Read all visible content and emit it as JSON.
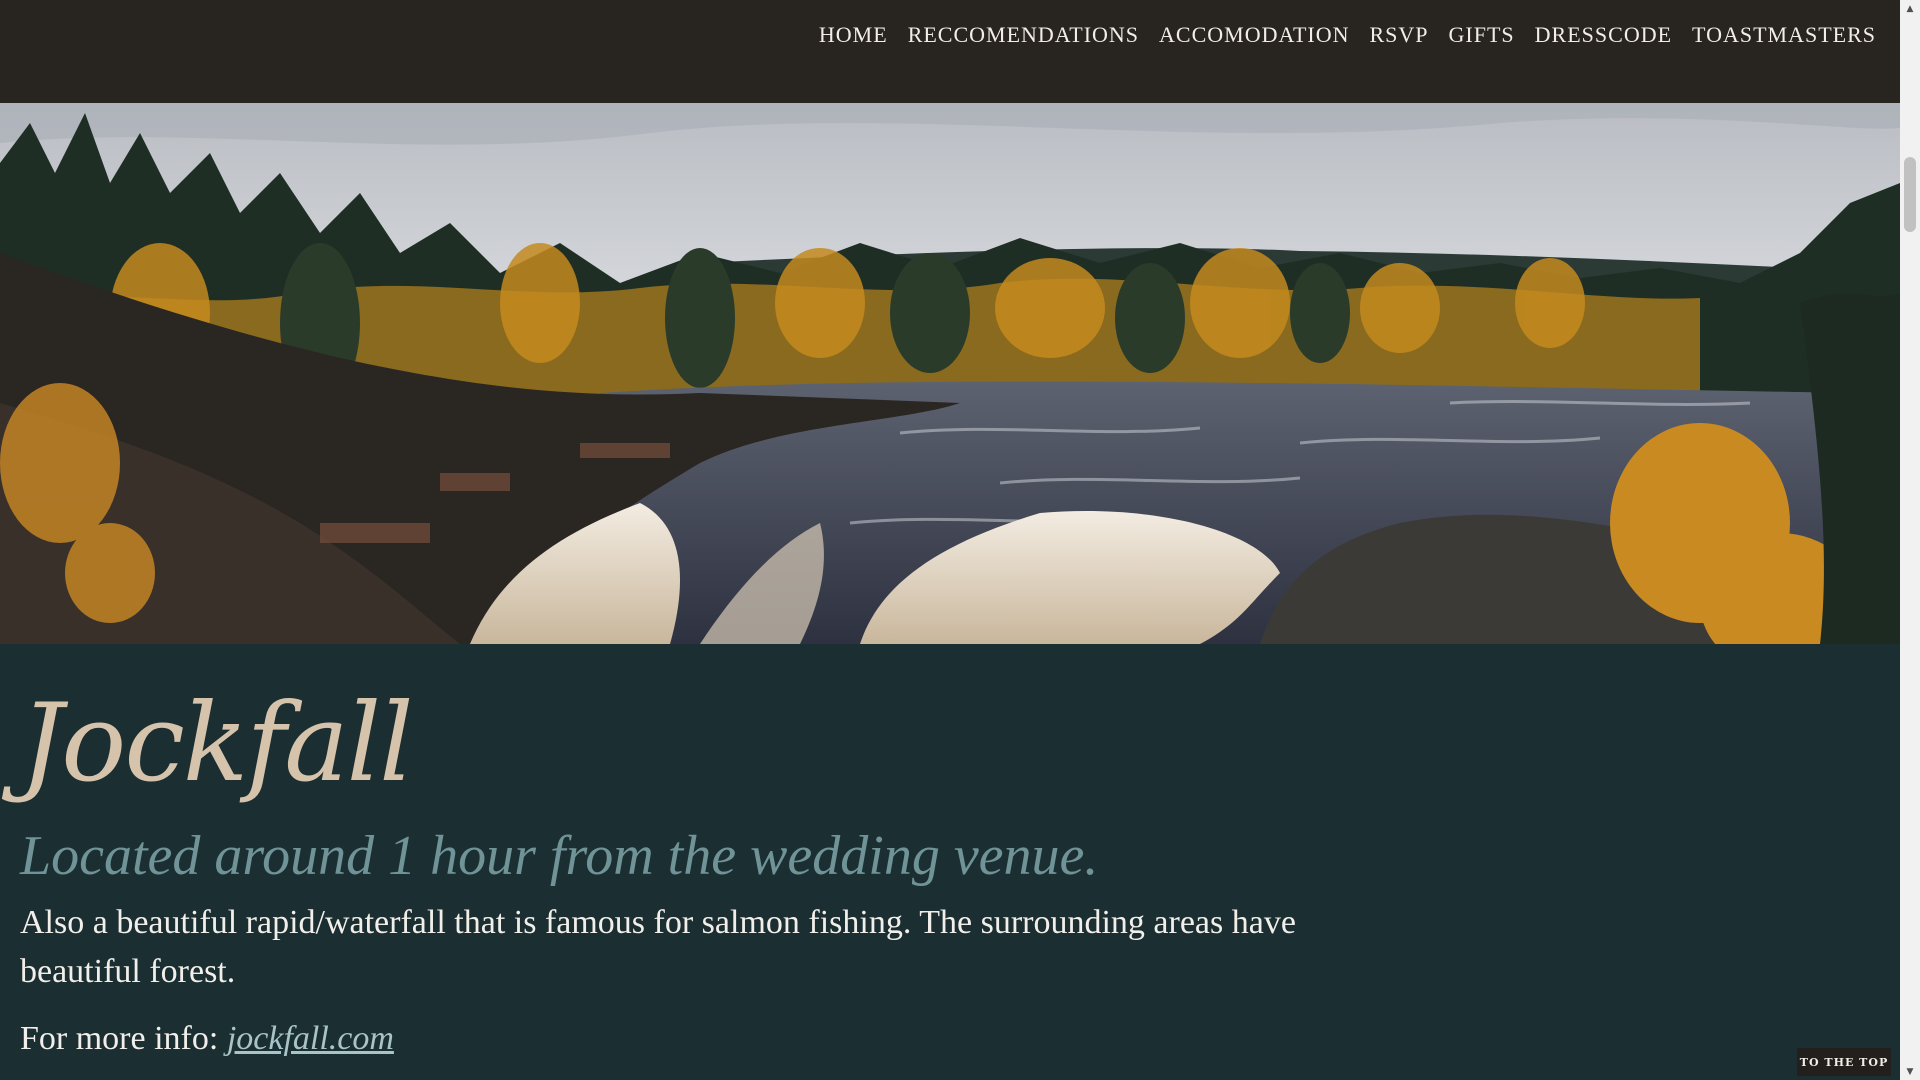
{
  "nav": {
    "items": [
      {
        "label": "HOME"
      },
      {
        "label": "RECCOMENDATIONS"
      },
      {
        "label": "ACCOMODATION"
      },
      {
        "label": "RSVP"
      },
      {
        "label": "GIFTS"
      },
      {
        "label": "DRESSCODE"
      },
      {
        "label": "TOASTMASTERS"
      }
    ]
  },
  "section": {
    "title": "Jockfall",
    "subtitle": "Located around 1 hour from the wedding venue.",
    "description": "Also a beautiful rapid/waterfall that is famous for salmon fishing. The surrounding areas have beautiful forest.",
    "more_info_label": "For more info:",
    "more_info_link": "jockfall.com"
  },
  "to_top": {
    "label": "TO THE TOP"
  },
  "colors": {
    "nav_bg": "#282420",
    "content_bg": "#1b2e31",
    "title": "#d6c3ab",
    "subtitle": "#6f9397",
    "link": "#a9c4c6"
  },
  "icons": {
    "scroll_up": "scroll-up-arrow-icon",
    "scroll_down": "scroll-down-arrow-icon"
  }
}
